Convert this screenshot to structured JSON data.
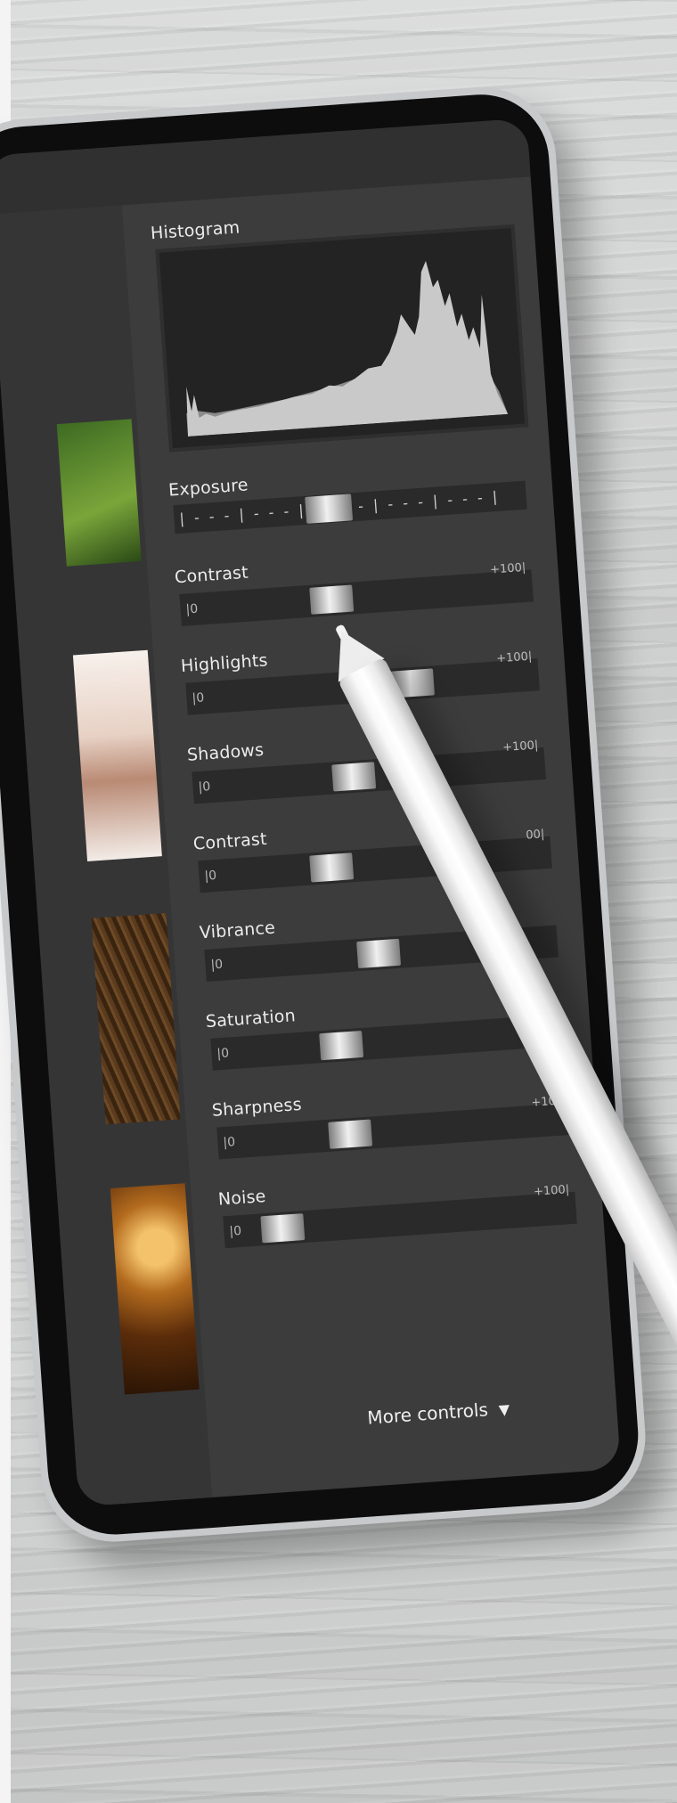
{
  "panel": {
    "histogram_label": "Histogram",
    "exposure_label": "Exposure",
    "exposure_ticks": "| - - - | - - - | -        - - - | - - - | - - - |",
    "controls": [
      {
        "label": "Contrast",
        "zero": "|0",
        "max": "+100|",
        "value": 0.42
      },
      {
        "label": "Highlights",
        "zero": "|0",
        "max": "+100|",
        "value": 0.66
      },
      {
        "label": "Shadows",
        "zero": "|0",
        "max": "+100|",
        "value": 0.45
      },
      {
        "label": "Contrast",
        "zero": "|0",
        "max": "00|",
        "value": 0.36
      },
      {
        "label": "Vibrance",
        "zero": "|0",
        "max": "",
        "value": 0.49
      },
      {
        "label": "Saturation",
        "zero": "|0",
        "max": "+",
        "value": 0.35
      },
      {
        "label": "Sharpness",
        "zero": "|0",
        "max": "+100",
        "value": 0.36
      },
      {
        "label": "Noise",
        "zero": "|0",
        "max": "+100|",
        "value": 0.12
      }
    ],
    "more_controls": "More controls"
  },
  "colors": {
    "panel_bg": "#3c3c3d",
    "track": "#2a2a2b",
    "histogram_fill_light": "#c8c8c8",
    "histogram_fill_dark": "#8a8a8a"
  }
}
